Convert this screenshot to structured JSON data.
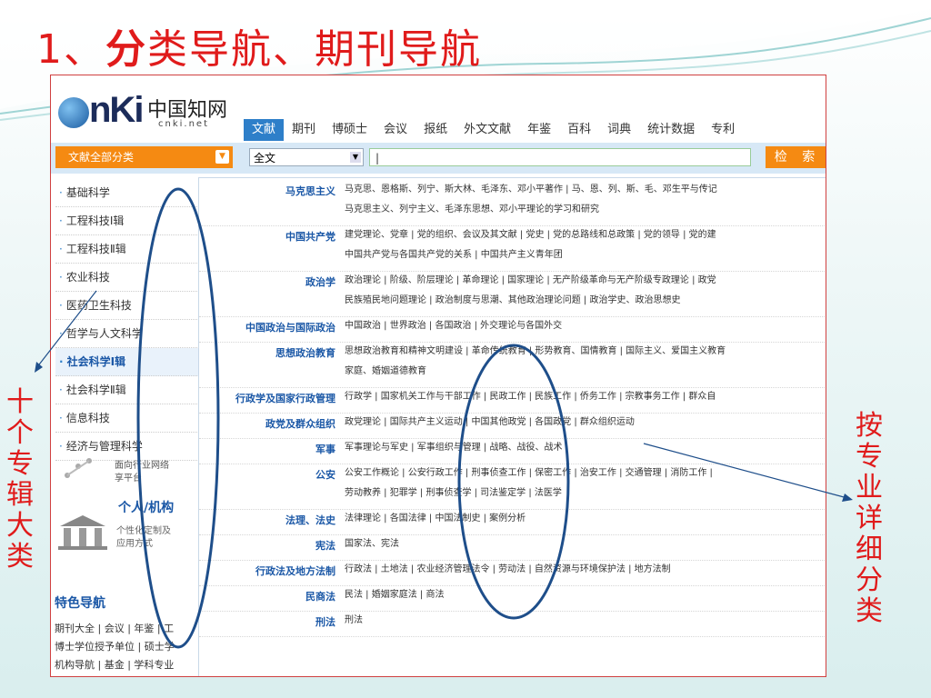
{
  "slide": {
    "title_num": "1、",
    "title_bold": "分",
    "title_rest": "类导航、期刊导航"
  },
  "header": {
    "logo_cn": "中国知网",
    "logo_net": "cnki.net",
    "tabs": [
      "文献",
      "期刊",
      "博硕士",
      "会议",
      "报纸",
      "外文文献",
      "年鉴",
      "百科",
      "词典",
      "统计数据",
      "专利"
    ]
  },
  "search": {
    "category_dropdown": "文献全部分类",
    "field_select": "全文",
    "query": "|",
    "button": "检 索"
  },
  "categories": [
    "基础科学",
    "工程科技Ⅰ辑",
    "工程科技Ⅱ辑",
    "农业科技",
    "医药卫生科技",
    "哲学与人文科学",
    "社会科学Ⅰ辑",
    "社会科学Ⅱ辑",
    "信息科技",
    "经济与管理科学"
  ],
  "selected_category": 6,
  "left_below": {
    "industry_line1": "面向行业网络",
    "industry_line2": "享平台",
    "personal_title": "个人/机构",
    "personal_desc1": "个性化定制及",
    "personal_desc2": "应用方式",
    "feature_title": "特色导航",
    "feature_rows": [
      "期刊大全 | 会议 | 年鉴 | 工",
      "博士学位授予单位 | 硕士学",
      "机构导航 | 基金 | 学科专业"
    ]
  },
  "subcategories": [
    {
      "title": "马克思主义",
      "lines": [
        "马克思、恩格斯、列宁、斯大林、毛泽东、邓小平著作 | 马、恩、列、斯、毛、邓生平与传记",
        "马克思主义、列宁主义、毛泽东思想、邓小平理论的学习和研究"
      ]
    },
    {
      "title": "中国共产党",
      "lines": [
        "建党理论、党章 | 党的组织、会议及其文献 | 党史 | 党的总路线和总政策 | 党的领导 | 党的建",
        "中国共产党与各国共产党的关系 | 中国共产主义青年团"
      ]
    },
    {
      "title": "政治学",
      "lines": [
        "政治理论 | 阶级、阶层理论 | 革命理论 | 国家理论 | 无产阶级革命与无产阶级专政理论 | 政党",
        "民族殖民地问题理论 | 政治制度与思潮、其他政治理论问题 | 政治学史、政治思想史"
      ]
    },
    {
      "title": "中国政治与国际政治",
      "lines": [
        "中国政治 | 世界政治 | 各国政治 | 外交理论与各国外交"
      ]
    },
    {
      "title": "思想政治教育",
      "lines": [
        "思想政治教育和精神文明建设 | 革命传统教育 | 形势教育、国情教育 | 国际主义、爱国主义教育",
        "家庭、婚姻道德教育"
      ]
    },
    {
      "title": "行政学及国家行政管理",
      "lines": [
        "行政学 | 国家机关工作与干部工作 | 民政工作 | 民族工作 | 侨务工作 | 宗教事务工作 | 群众自"
      ]
    },
    {
      "title": "政党及群众组织",
      "lines": [
        "政党理论 | 国际共产主义运动 | 中国其他政党 | 各国政党 | 群众组织运动"
      ]
    },
    {
      "title": "军事",
      "lines": [
        "军事理论与军史 | 军事组织与管理 | 战略、战役、战术"
      ]
    },
    {
      "title": "公安",
      "lines": [
        "公安工作概论 | 公安行政工作 | 刑事侦查工作 | 保密工作 | 治安工作 | 交通管理 | 消防工作 |",
        "劳动教养 | 犯罪学 | 刑事侦查学 | 司法鉴定学 | 法医学"
      ]
    },
    {
      "title": "法理、法史",
      "lines": [
        "法律理论 | 各国法律 | 中国法制史 | 案例分析"
      ]
    },
    {
      "title": "宪法",
      "lines": [
        "国家法、宪法"
      ]
    },
    {
      "title": "行政法及地方法制",
      "lines": [
        "行政法 | 土地法 | 农业经济管理法令 | 劳动法 | 自然资源与环境保护法 | 地方法制"
      ]
    },
    {
      "title": "民商法",
      "lines": [
        "民法 | 婚姻家庭法 | 商法"
      ]
    },
    {
      "title": "刑法",
      "lines": [
        "刑法"
      ]
    }
  ],
  "annotations": {
    "left": "十个专辑大类",
    "right": "按专业详细分类"
  },
  "colors": {
    "title_red": "#e01b1b",
    "accent_orange": "#f58a12",
    "link_blue": "#1a57a6",
    "tab_blue": "#2e7fc9",
    "ellipse": "#1e4e8a"
  }
}
